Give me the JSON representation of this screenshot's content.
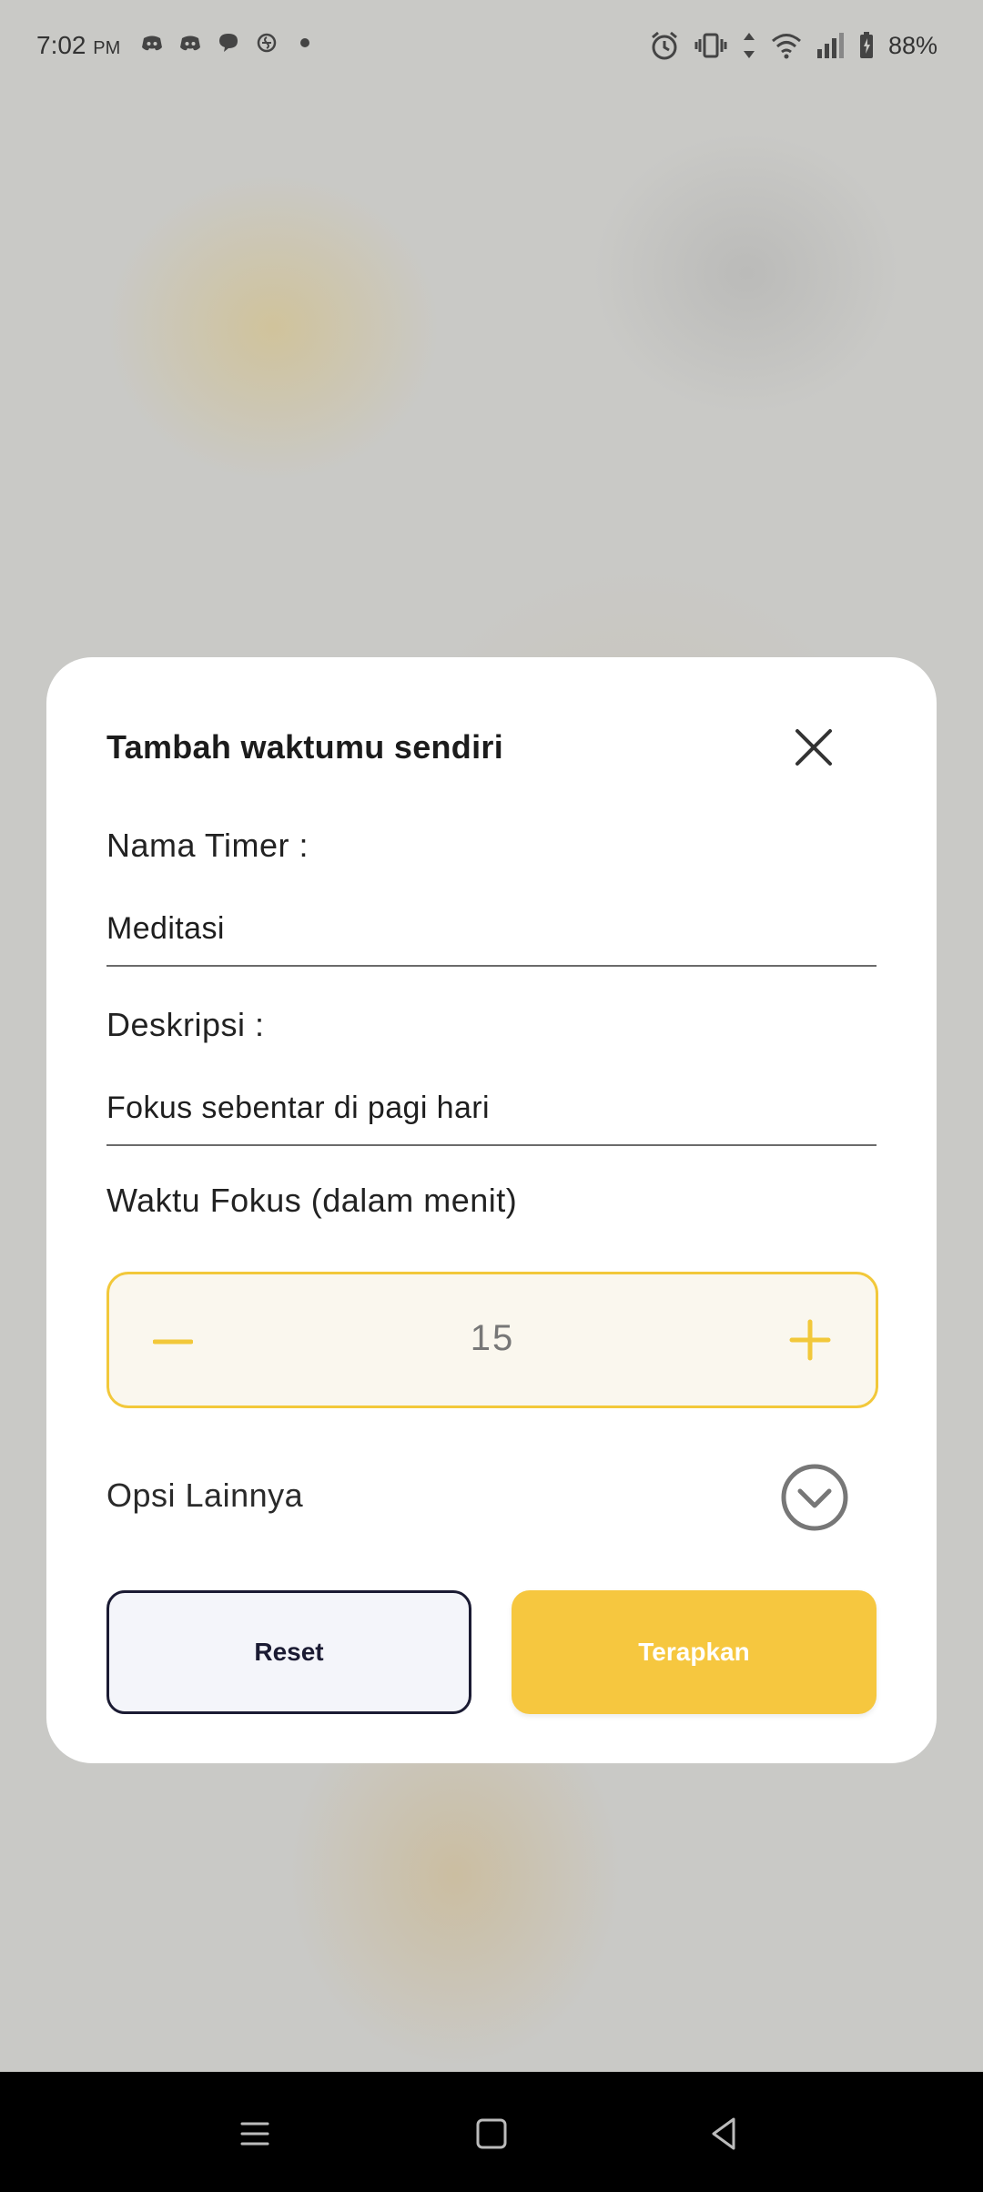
{
  "status_bar": {
    "time": "7:02",
    "ampm": "PM",
    "battery": "88%",
    "left_icons": [
      "discord-icon",
      "discord-icon",
      "chat-bubble-icon",
      "app-icon",
      "dot-icon"
    ],
    "right_icons": [
      "alarm-icon",
      "vibrate-icon",
      "data-arrows-icon",
      "wifi-icon",
      "signal-icon",
      "battery-icon"
    ]
  },
  "dialog": {
    "title": "Tambah waktumu sendiri",
    "name_label": "Nama Timer :",
    "name_value": "Meditasi",
    "desc_label": "Deskripsi :",
    "desc_value": "Fokus sebentar di pagi hari",
    "focus_label": "Waktu Fokus (dalam menit)",
    "focus_value": "15",
    "more_options_label": "Opsi Lainnya",
    "reset_label": "Reset",
    "apply_label": "Terapkan"
  },
  "colors": {
    "accent": "#f6c73f",
    "stepper_border": "#f2c83a",
    "stepper_bg": "#faf7ee",
    "reset_border": "#1b1b33",
    "overlay_bg": "#c9c9c6"
  },
  "nav_bar": {
    "icons": [
      "menu-icon",
      "home-square-icon",
      "back-triangle-icon"
    ]
  }
}
